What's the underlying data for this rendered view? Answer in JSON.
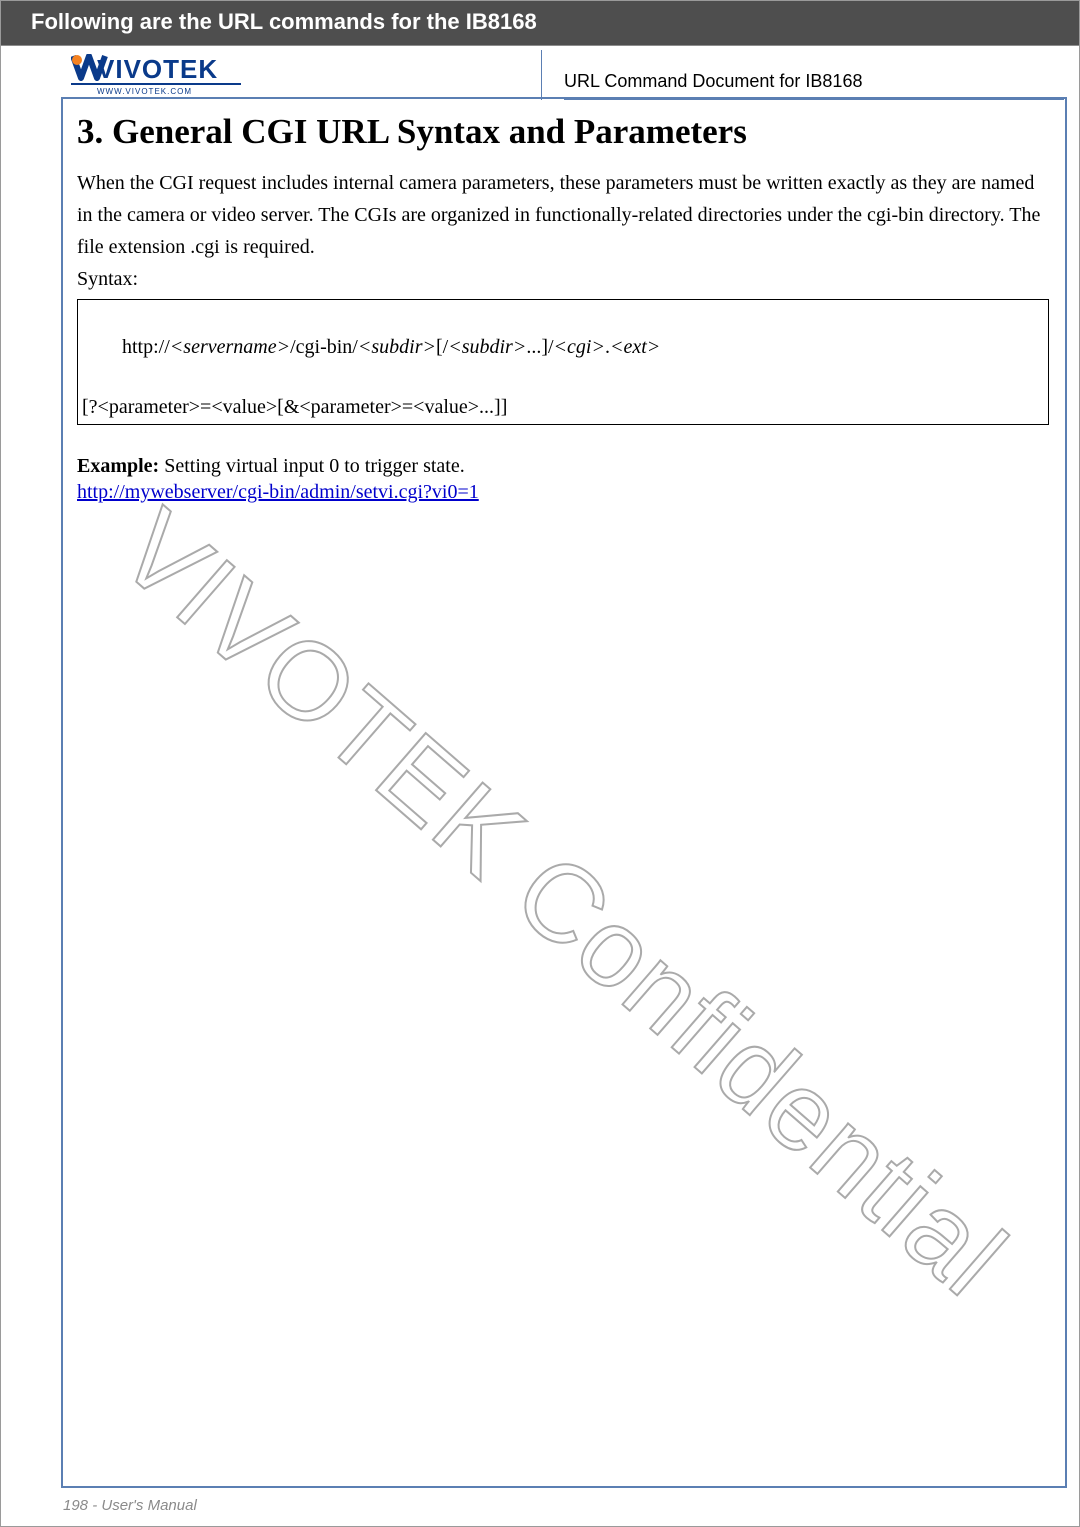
{
  "banner": {
    "title": "Following are the URL commands for the IB8168"
  },
  "header": {
    "brand": "VIVOTEK",
    "brand_sub": "www.vivotek.com",
    "doc_label": "URL Command Document for IB8168"
  },
  "section": {
    "title": "3. General CGI URL Syntax and Parameters",
    "body": "When the CGI request includes internal camera parameters, these parameters must be written exactly as they are named in the camera or video server. The CGIs are organized in functionally-related directories under the cgi-bin directory. The file extension .cgi is required.",
    "syntax_label": "Syntax:",
    "syntax_parts": {
      "p1": "http://",
      "p2": "<servername>",
      "p3": "/cgi-bin/",
      "p4": "<subdir>",
      "p5": "[/",
      "p6": "<subdir>",
      "p7": "...]/",
      "p8": "<cgi>",
      "p9": ".",
      "p10": "<ext>",
      "q1": "[?<parameter>=<value>[&<parameter>=<value>...]]"
    },
    "example_label": "Example:",
    "example_text": " Setting virtual input 0 to trigger state.",
    "example_url": "http://mywebserver/cgi-bin/admin/setvi.cgi?vi0=1"
  },
  "watermark": "VIVOTEK Confidential",
  "footer": {
    "page": "198",
    "sep": " - ",
    "label": "User's Manual"
  }
}
